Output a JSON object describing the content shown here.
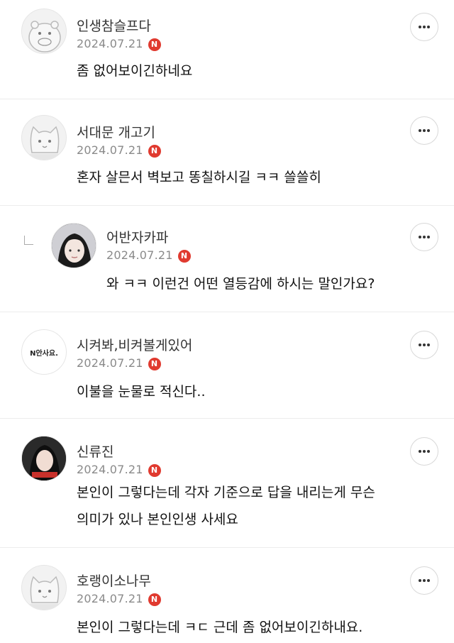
{
  "comments": [
    {
      "name": "인생참슬프다",
      "date": "2024.07.21",
      "badge": "N",
      "text": "좀 없어보이긴하네요",
      "avatar": "hippo-avatar-icon"
    },
    {
      "name": "서대문 개고기",
      "date": "2024.07.21",
      "badge": "N",
      "text": "혼자 살믄서 벽보고 똥칠하시길 ㅋㅋ 쓸쓸히",
      "avatar": "cat-avatar-icon"
    },
    {
      "name": "어반자카파",
      "date": "2024.07.21",
      "badge": "N",
      "text": "와 ㅋㅋ 이런건 어떤 열등감에 하시는 말인가요?",
      "avatar": "photo-avatar",
      "reply": true
    },
    {
      "name": "시켜봐,비켜볼게있어",
      "date": "2024.07.21",
      "badge": "N",
      "text": "이불을 눈물로 적신다..",
      "avatar_text": "N안사요."
    },
    {
      "name": "신류진",
      "date": "2024.07.21",
      "badge": "N",
      "text_lines": [
        "본인이 그렇다는데 각자 기준으로 답을 내리는게 무슨",
        "의미가 있나 본인인생 사세요"
      ],
      "avatar": "photo-avatar"
    },
    {
      "name": "호랭이소나무",
      "date": "2024.07.21",
      "badge": "N",
      "text": "본인이 그렇다는데 ㅋㄷ 근데 좀 없어보이긴하내요.",
      "avatar": "cat-avatar-icon"
    }
  ],
  "colors": {
    "badge": "#e03a2f",
    "divider": "#ececec",
    "date": "#8a8a8a"
  }
}
